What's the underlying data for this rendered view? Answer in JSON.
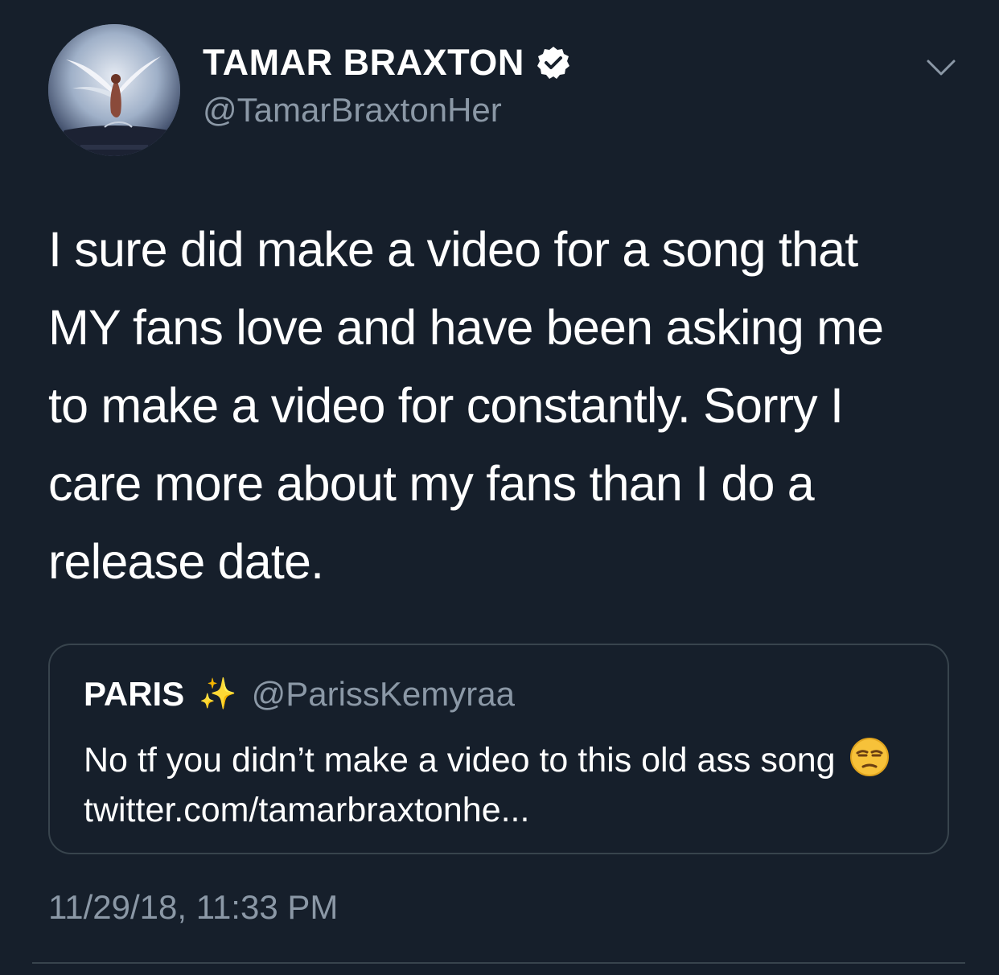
{
  "tweet": {
    "display_name": "TAMAR BRAXTON",
    "verified": true,
    "handle": "@TamarBraxtonHer",
    "text": "I sure did make a video for a song that\nMY fans love and have been asking me\nto make a video for constantly. Sorry I\ncare more about my fans than I do a\nrelease date.",
    "timestamp": "11/29/18, 11:33 PM",
    "menu_icon": "chevron-down-icon"
  },
  "quote": {
    "display_name": "PARIS",
    "name_emoji": "✨",
    "handle": "@ParissKemyraa",
    "text_before_emoji": "No tf you didn’t make a video to this old ass song",
    "emoji": "unamused-face",
    "link": "twitter.com/tamarbraxtonhe..."
  },
  "colors": {
    "background": "#161f2b",
    "text_primary": "#ffffff",
    "text_secondary": "#8b98a6",
    "border": "#38444d",
    "verified_badge": "#ffffff"
  }
}
